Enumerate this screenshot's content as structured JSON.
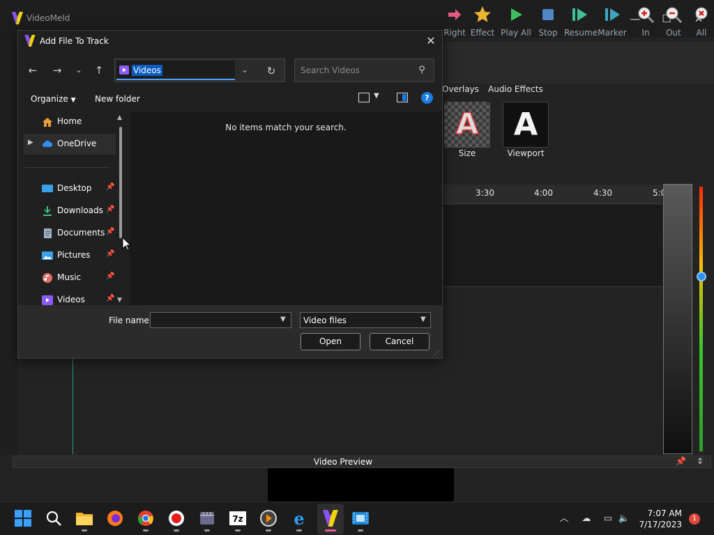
{
  "app": {
    "title": "VideoMeld",
    "accent_green": "#1aa085",
    "toolbar": [
      {
        "label": "Right",
        "icon": "arrow-right-icon"
      },
      {
        "label": "Effect",
        "icon": "star-icon"
      },
      {
        "label": "Play All",
        "icon": "play-icon"
      },
      {
        "label": "Stop",
        "icon": "stop-icon"
      },
      {
        "label": "Resume",
        "icon": "resume-icon"
      },
      {
        "label": "Marker",
        "icon": "marker-icon"
      },
      {
        "label": "In",
        "icon": "zoom-in-icon"
      },
      {
        "label": "Out",
        "icon": "zoom-out-icon"
      },
      {
        "label": "All",
        "icon": "zoom-all-icon"
      }
    ],
    "tabs": [
      "Overlays",
      "Audio Effects"
    ],
    "effects": [
      {
        "label": "Size"
      },
      {
        "label": "Viewport"
      }
    ],
    "ruler_ticks": [
      "3:30",
      "4:00",
      "4:30",
      "5:0"
    ],
    "preview_label": "Video Preview"
  },
  "dialog": {
    "title": "Add File To Track",
    "address": "Videos",
    "search_placeholder": "Search Videos",
    "organize": "Organize",
    "new_folder": "New folder",
    "empty_message": "No items match your search.",
    "nav_items": [
      {
        "label": "Home",
        "icon": "home-icon",
        "pinned": false
      },
      {
        "label": "OneDrive",
        "icon": "cloud-icon",
        "pinned": false
      },
      {
        "label": "Desktop",
        "icon": "desktop-icon",
        "pinned": true
      },
      {
        "label": "Downloads",
        "icon": "download-icon",
        "pinned": true
      },
      {
        "label": "Documents",
        "icon": "document-icon",
        "pinned": true
      },
      {
        "label": "Pictures",
        "icon": "picture-icon",
        "pinned": true
      },
      {
        "label": "Music",
        "icon": "music-icon",
        "pinned": true
      },
      {
        "label": "Videos",
        "icon": "video-icon",
        "pinned": true
      }
    ],
    "file_name_label": "File name:",
    "file_name_value": "",
    "file_type": "Video files",
    "open_label": "Open",
    "cancel_label": "Cancel"
  },
  "taskbar": {
    "time": "7:07 AM",
    "date": "7/17/2023",
    "notification_count": "1",
    "apps": [
      "start-icon",
      "search-icon",
      "file-explorer-icon",
      "firefox-icon",
      "chrome-icon",
      "record-icon",
      "video-editor-icon",
      "7zip-icon",
      "media-player-icon",
      "ie-icon",
      "videomeld-icon",
      "movie-maker-icon"
    ]
  }
}
